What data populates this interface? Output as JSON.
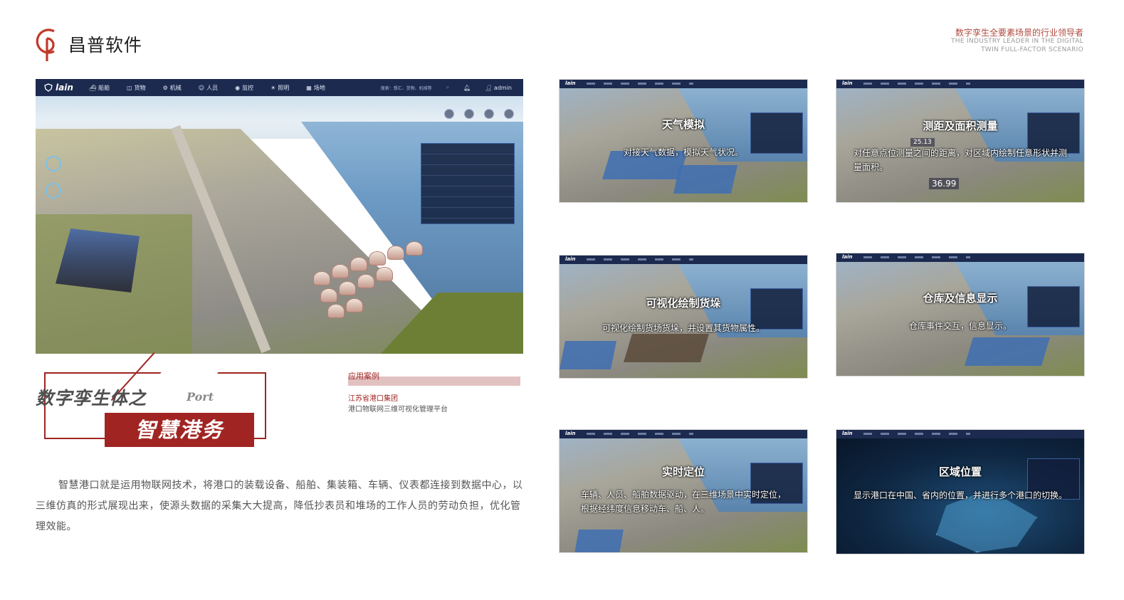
{
  "brand": {
    "logo_letters": "CP",
    "name": "昌普软件",
    "tagline_cn": "数字孪生全要素场景的行业领导者",
    "tagline_en_1": "THE INDUSTRY LEADER IN THE DIGITAL",
    "tagline_en_2": "TWIN FULL-FACTOR SCENARIO"
  },
  "main_screenshot": {
    "app_logo": "lain",
    "nav": [
      {
        "label": "船舶",
        "icon": "ship-icon"
      },
      {
        "label": "货物",
        "icon": "cargo-icon"
      },
      {
        "label": "机械",
        "icon": "machine-icon"
      },
      {
        "label": "人员",
        "icon": "people-icon"
      },
      {
        "label": "监控",
        "icon": "monitor-icon"
      },
      {
        "label": "照明",
        "icon": "light-icon"
      },
      {
        "label": "场地",
        "icon": "yard-icon"
      }
    ],
    "search_placeholder": "搜索：想汇、货物、机械等",
    "user": "admin"
  },
  "title": {
    "line1": "数字孪生体之",
    "port": "Port",
    "main": "智慧港务"
  },
  "case": {
    "label": "应用案例",
    "company": "江苏省港口集团",
    "platform": "港口物联网三维可视化管理平台"
  },
  "description": "智慧港口就是运用物联网技术，将港口的装载设备、船舶、集装箱、车辆、仪表都连接到数据中心，以三维仿真的形式展现出来，使源头数据的采集大大提高，降低抄表员和堆场的工作人员的劳动负担，优化管理效能。",
  "thumbnails": [
    {
      "title": "天气模拟",
      "desc": "对接天气数据，模拟天气状况。"
    },
    {
      "title": "测距及面积测量",
      "desc": "对任意点位测量之间的距离，对区域内绘制任意形状并测量面积。",
      "measure_1": "25.13",
      "measure_2": "36.99"
    },
    {
      "title": "可视化绘制货垛",
      "desc": "可视化绘制货场货垛，并设置其货物属性。"
    },
    {
      "title": "仓库及信息显示",
      "desc": "仓库事件交互，信息显示。"
    },
    {
      "title": "实时定位",
      "desc": "车辆、人员、船舶数据驱动，在三维场景中实时定位，根据经纬度信息移动车、船、人。"
    },
    {
      "title": "区域位置",
      "desc": "显示港口在中国、省内的位置，并进行多个港口的切换。"
    }
  ],
  "colors": {
    "brand_red": "#a02522",
    "navbar": "#1c2a4f"
  }
}
